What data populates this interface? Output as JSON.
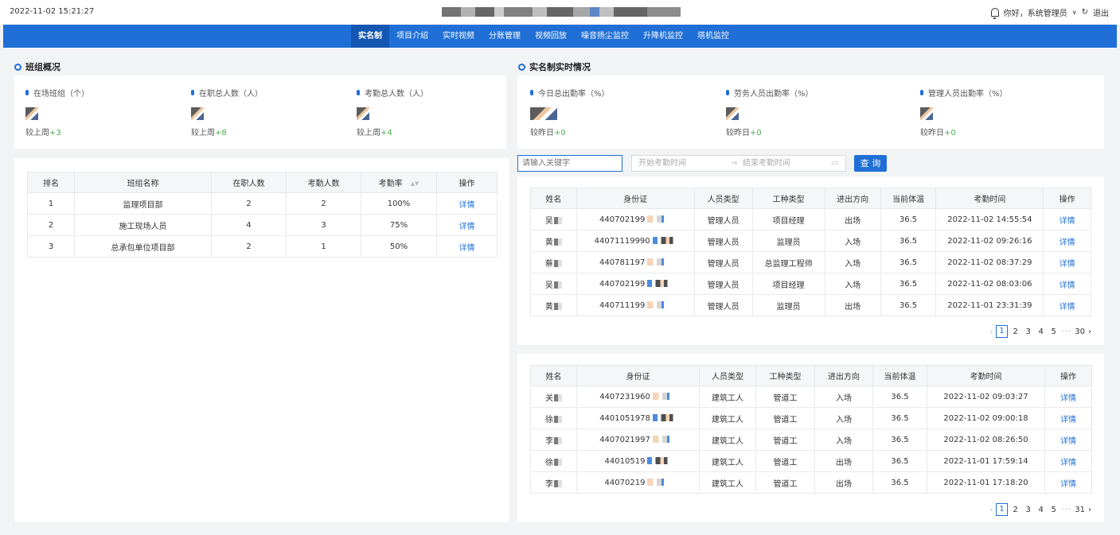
{
  "header": {
    "datetime": "2022-11-02 15:21:27",
    "greeting": "你好，系统管理员",
    "logout": "退出"
  },
  "nav": {
    "items": [
      "实名制",
      "项目介绍",
      "实时视频",
      "分账管理",
      "视频回放",
      "噪音扬尘监控",
      "升降机监控",
      "塔机监控"
    ],
    "active": 0
  },
  "team_overview": {
    "title": "班组概况",
    "stats": [
      {
        "label": "在场班组（个）",
        "compare": "较上周",
        "delta": "+3"
      },
      {
        "label": "在职总人数（人）",
        "compare": "较上周",
        "delta": "+8"
      },
      {
        "label": "考勤总人数（人）",
        "compare": "较上周",
        "delta": "+4"
      }
    ],
    "table": {
      "headers": [
        "排名",
        "班组名称",
        "在职人数",
        "考勤人数",
        "考勤率",
        "操作"
      ],
      "rows": [
        [
          "1",
          "监理项目部",
          "2",
          "2",
          "100%",
          "详情"
        ],
        [
          "2",
          "施工现场人员",
          "4",
          "3",
          "75%",
          "详情"
        ],
        [
          "3",
          "总承包单位项目部",
          "2",
          "1",
          "50%",
          "详情"
        ]
      ]
    }
  },
  "realname": {
    "title": "实名制实时情况",
    "stats": [
      {
        "label": "今日总出勤率（%）",
        "compare": "较昨日",
        "delta": "+0"
      },
      {
        "label": "劳务人员出勤率（%）",
        "compare": "较昨日",
        "delta": "+0"
      },
      {
        "label": "管理人员出勤率（%）",
        "compare": "较昨日",
        "delta": "+0"
      }
    ],
    "search": {
      "keyword_placeholder": "请输入关键字",
      "start_placeholder": "开始考勤时间",
      "range_sep": "→",
      "end_placeholder": "结束考勤时间",
      "button": "查 询"
    },
    "headers": [
      "姓名",
      "身份证",
      "人员类型",
      "工种类型",
      "进出方向",
      "当前体温",
      "考勤时间",
      "操作"
    ],
    "managers": [
      {
        "name": "吴",
        "id": "440702199",
        "type": "管理人员",
        "job": "项目经理",
        "dir": "出场",
        "temp": "36.5",
        "time": "2022-11-02 14:55:54",
        "op": "详情"
      },
      {
        "name": "黄",
        "id": "44071119990",
        "type": "管理人员",
        "job": "监理员",
        "dir": "入场",
        "temp": "36.5",
        "time": "2022-11-02 09:26:16",
        "op": "详情"
      },
      {
        "name": "蔡",
        "id": "440781197",
        "type": "管理人员",
        "job": "总监理工程师",
        "dir": "入场",
        "temp": "36.5",
        "time": "2022-11-02 08:37:29",
        "op": "详情"
      },
      {
        "name": "吴",
        "id": "440702199",
        "type": "管理人员",
        "job": "项目经理",
        "dir": "入场",
        "temp": "36.5",
        "time": "2022-11-02 08:03:06",
        "op": "详情"
      },
      {
        "name": "黄",
        "id": "440711199",
        "type": "管理人员",
        "job": "监理员",
        "dir": "出场",
        "temp": "36.5",
        "time": "2022-11-01 23:31:39",
        "op": "详情"
      }
    ],
    "managers_pager": {
      "pages": [
        "1",
        "2",
        "3",
        "4",
        "5"
      ],
      "ellipsis": "···",
      "last": "30"
    },
    "workers": [
      {
        "name": "关",
        "id": "4407231960",
        "type": "建筑工人",
        "job": "管道工",
        "dir": "入场",
        "temp": "36.5",
        "time": "2022-11-02 09:03:27",
        "op": "详情"
      },
      {
        "name": "徐",
        "id": "4401051978",
        "type": "建筑工人",
        "job": "管道工",
        "dir": "入场",
        "temp": "36.5",
        "time": "2022-11-02 09:00:18",
        "op": "详情"
      },
      {
        "name": "李",
        "id": "4407021997",
        "type": "建筑工人",
        "job": "管道工",
        "dir": "入场",
        "temp": "36.5",
        "time": "2022-11-02 08:26:50",
        "op": "详情"
      },
      {
        "name": "徐",
        "id": "44010519",
        "type": "建筑工人",
        "job": "管道工",
        "dir": "出场",
        "temp": "36.5",
        "time": "2022-11-01 17:59:14",
        "op": "详情"
      },
      {
        "name": "李",
        "id": "44070219",
        "type": "建筑工人",
        "job": "管道工",
        "dir": "出场",
        "temp": "36.5",
        "time": "2022-11-01 17:18:20",
        "op": "详情"
      }
    ],
    "workers_pager": {
      "pages": [
        "1",
        "2",
        "3",
        "4",
        "5"
      ],
      "ellipsis": "···",
      "last": "31"
    }
  },
  "colors": {
    "primary": "#1f6fd6",
    "nav_active": "#1457b3",
    "positive": "#4caf50"
  }
}
